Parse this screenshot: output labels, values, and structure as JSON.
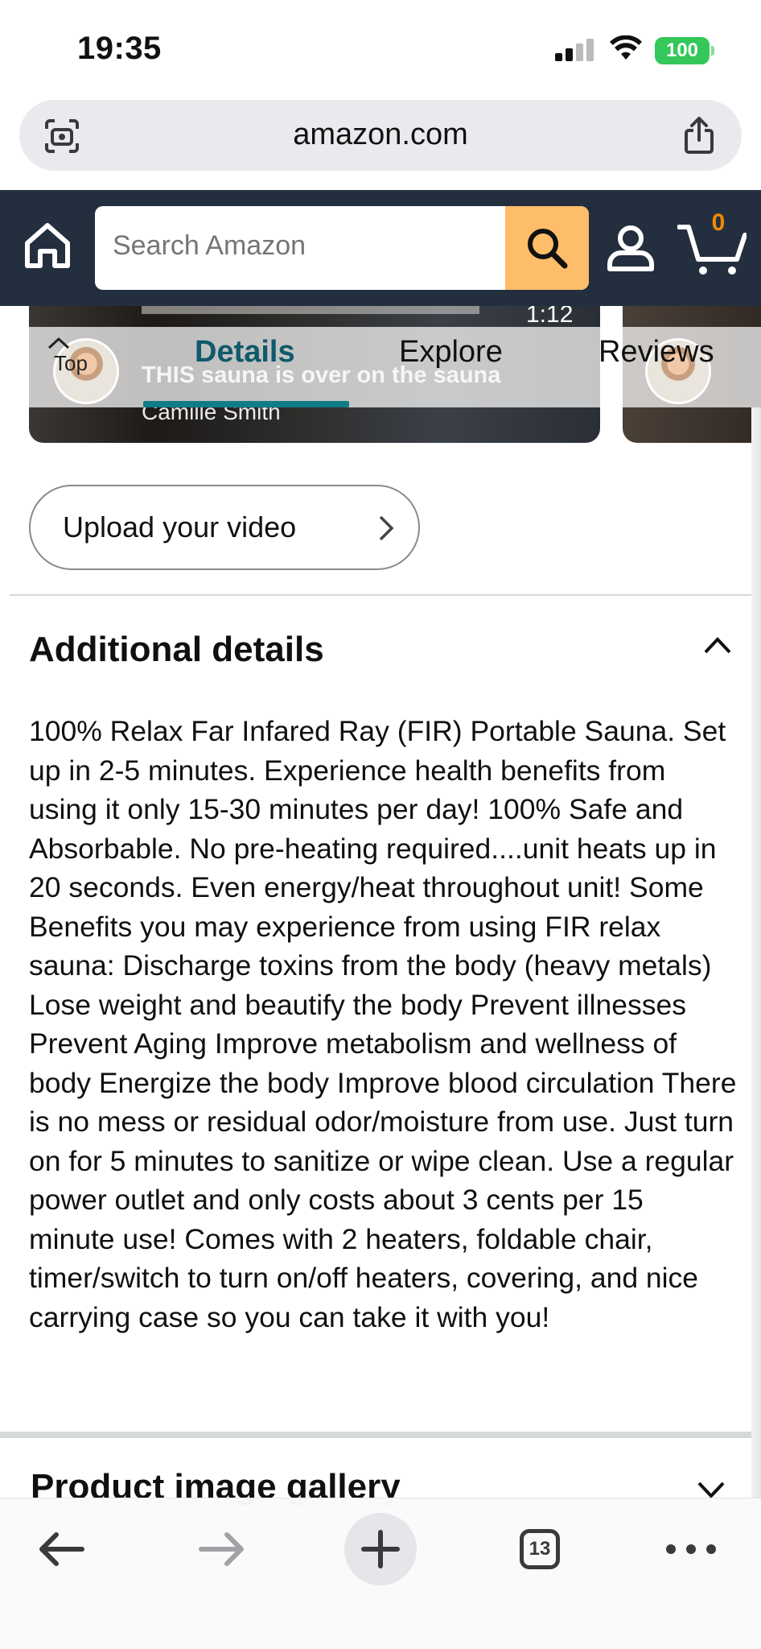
{
  "status_bar": {
    "time": "19:35",
    "battery": "100"
  },
  "browser": {
    "url": "amazon.com",
    "tab_count": "13"
  },
  "header": {
    "search_placeholder": "Search Amazon",
    "cart_count": "0"
  },
  "video": {
    "duration": "1:12",
    "title": "THIS sauna is over on the sauna",
    "author": "Camille Smith"
  },
  "tabs": {
    "top_label": "Top",
    "items": [
      {
        "label": "Details",
        "active": true
      },
      {
        "label": "Explore",
        "active": false
      },
      {
        "label": "Reviews",
        "active": false
      }
    ]
  },
  "upload": {
    "label": "Upload your video"
  },
  "additional_details": {
    "title": "Additional details",
    "expanded": true,
    "text": "100% Relax Far Infared Ray (FIR) Portable Sauna. Set up in 2-5 minutes. Experience health benefits from using it only 15-30 minutes per day! 100% Safe and Absorbable. No pre-heating required....unit heats up in 20 seconds. Even energy/heat throughout unit! Some Benefits you may experience from using FIR relax sauna: Discharge toxins from the body (heavy metals) Lose weight and beautify the body Prevent illnesses Prevent Aging Improve metabolism and wellness of body Energize the body Improve blood circulation There is no mess or residual odor/moisture from use. Just turn on for 5 minutes to sanitize or wipe clean. Use a regular power outlet and only costs about 3 cents per 15 minute use! Comes with 2 heaters, foldable chair, timer/switch to turn on/off heaters, covering, and nice carrying case so you can take it with you!"
  },
  "gallery": {
    "title": "Product image gallery",
    "expanded": false
  },
  "colors": {
    "amazon_header": "#232f3e",
    "search_button": "#febd69",
    "cart_count": "#f08804",
    "active_tab": "#0f5a6b",
    "tab_underline": "#107c87",
    "battery": "#34c759"
  },
  "icons": {
    "url_bar_left": "camera-scan-icon",
    "url_bar_right": "share-icon",
    "home": "home-icon",
    "search": "search-icon",
    "account": "account-icon",
    "cart": "cart-icon",
    "toolbar": [
      "back-arrow-icon",
      "forward-arrow-icon",
      "plus-icon",
      "tabs-icon",
      "more-icon"
    ]
  }
}
